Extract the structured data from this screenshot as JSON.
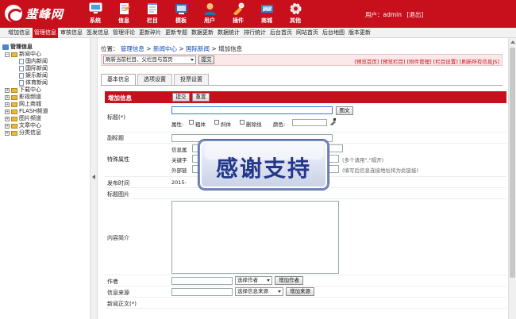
{
  "header": {
    "logo_text": "蜚峰网",
    "nav": [
      {
        "label": "系统",
        "icon": "computer-icon"
      },
      {
        "label": "信息",
        "icon": "document-icon"
      },
      {
        "label": "栏目",
        "icon": "notepad-icon"
      },
      {
        "label": "模板",
        "icon": "template-icon"
      },
      {
        "label": "用户",
        "icon": "user-icon"
      },
      {
        "label": "插件",
        "icon": "plugin-icon"
      },
      {
        "label": "商城",
        "icon": "shop-icon"
      },
      {
        "label": "其他",
        "icon": "gear-icon"
      }
    ],
    "user_prefix": "用户：",
    "username": "admin",
    "logout": "[退出]"
  },
  "menu": [
    {
      "label": "增加信息",
      "active": false
    },
    {
      "label": "管理信息",
      "active": true
    },
    {
      "label": "审核信息",
      "active": false
    },
    {
      "label": "签发信息",
      "active": false
    },
    {
      "label": "管理评论",
      "active": false
    },
    {
      "label": "更新碎片",
      "active": false
    },
    {
      "label": "更新专题",
      "active": false
    },
    {
      "label": "数据更新",
      "active": false
    },
    {
      "label": "数据统计",
      "active": false
    },
    {
      "label": "排行统计",
      "active": false
    },
    {
      "label": "后台首页",
      "active": false
    },
    {
      "label": "网站首页",
      "active": false
    },
    {
      "label": "后台地图",
      "active": false
    },
    {
      "label": "版本更新",
      "active": false
    }
  ],
  "tree": {
    "title": "管理信息",
    "nodes": [
      {
        "label": "新闻中心",
        "type": "open"
      },
      {
        "label": "国内新闻",
        "type": "doc"
      },
      {
        "label": "国际新闻",
        "type": "doc"
      },
      {
        "label": "娱乐新闻",
        "type": "doc"
      },
      {
        "label": "体育新闻",
        "type": "doc"
      },
      {
        "label": "下载中心",
        "type": "closed"
      },
      {
        "label": "影视频道",
        "type": "closed"
      },
      {
        "label": "网上商城",
        "type": "closed"
      },
      {
        "label": "FLASH频道",
        "type": "closed"
      },
      {
        "label": "图片频道",
        "type": "closed"
      },
      {
        "label": "文章中心",
        "type": "closed"
      },
      {
        "label": "分类信息",
        "type": "closed"
      }
    ]
  },
  "breadcrumb": {
    "prefix": "位置：",
    "items": [
      "管理信息",
      "新闻中心",
      "国际新闻"
    ],
    "current": "增加信息",
    "sep": " > "
  },
  "toolbar": {
    "refresh_select": "刷新当前栏目、父栏目与首页",
    "submit": "提交",
    "links": "[预览首页] [预览栏目] [附件管理] [栏目设置] [刷新所有信息JS]"
  },
  "tabs": [
    {
      "label": "基本信息",
      "active": true
    },
    {
      "label": "选项设置",
      "active": false
    },
    {
      "label": "投票设置",
      "active": false
    }
  ],
  "form": {
    "header": "增加信息",
    "submit": "提交",
    "reset": "重置",
    "title_label": "标题(*)",
    "title_image_btn": "图文",
    "attr_label": "属性:",
    "bold": "粗体",
    "italic": "斜体",
    "strike": "删除线",
    "color_label": "颜色:",
    "subtitle_label": "副标题",
    "special_label": "特殊属性",
    "info_attr_label": "信息属",
    "keyword_label": "关键字",
    "keyword_hint": "(多个请用\",\"隔开)",
    "external_label": "外部链",
    "external_hint": "(填写后信息连接地址将为此链接)",
    "pubtime_label": "发布时间",
    "pubtime_value": "2015-",
    "titlepic_label": "标题图片",
    "summary_label": "内容简介",
    "author_label": "作者",
    "author_select": "选择作者",
    "author_add": "增加作者",
    "source_label": "信息来源",
    "source_select": "选择信息来源",
    "source_add": "增加来源",
    "body_label": "新闻正文(*)"
  },
  "overlay": {
    "text": "感谢支持"
  },
  "colors": {
    "brand": "#c8101d",
    "link": "#0b48b8"
  }
}
